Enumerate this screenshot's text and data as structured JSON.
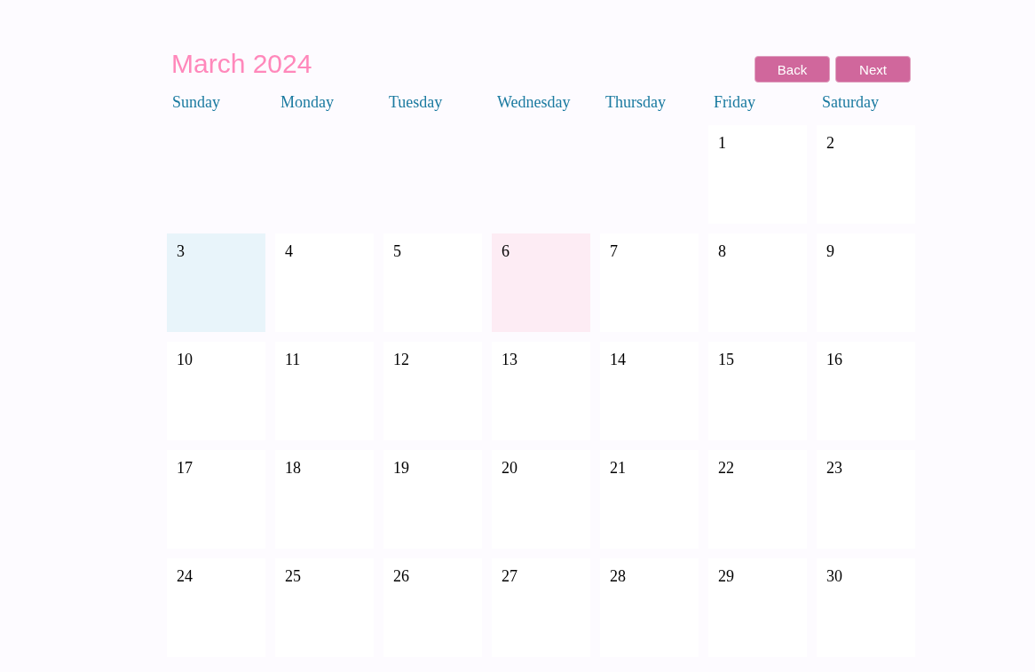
{
  "header": {
    "title": "March 2024",
    "buttons": [
      "Back",
      "Next"
    ]
  },
  "weekdays": [
    "Sunday",
    "Monday",
    "Tuesday",
    "Wednesday",
    "Thursday",
    "Friday",
    "Saturday"
  ],
  "weeks": [
    [
      {
        "day": "1"
      },
      {
        "day": "2"
      }
    ],
    [
      {
        "day": "3",
        "color": "#e8f4fa"
      },
      {
        "day": "4"
      },
      {
        "day": "5"
      },
      {
        "day": "6",
        "color": "#fdecf4"
      },
      {
        "day": "7"
      },
      {
        "day": "8"
      },
      {
        "day": "9"
      }
    ],
    [
      {
        "day": "10"
      },
      {
        "day": "11"
      },
      {
        "day": "12"
      },
      {
        "day": "13"
      },
      {
        "day": "14"
      },
      {
        "day": "15"
      },
      {
        "day": "16"
      }
    ],
    [
      {
        "day": "17"
      },
      {
        "day": "18"
      },
      {
        "day": "19"
      },
      {
        "day": "20"
      },
      {
        "day": "21"
      },
      {
        "day": "22"
      },
      {
        "day": "23"
      }
    ],
    [
      {
        "day": "24"
      },
      {
        "day": "25"
      },
      {
        "day": "26"
      },
      {
        "day": "27"
      },
      {
        "day": "28"
      },
      {
        "day": "29"
      },
      {
        "day": "30"
      }
    ]
  ]
}
